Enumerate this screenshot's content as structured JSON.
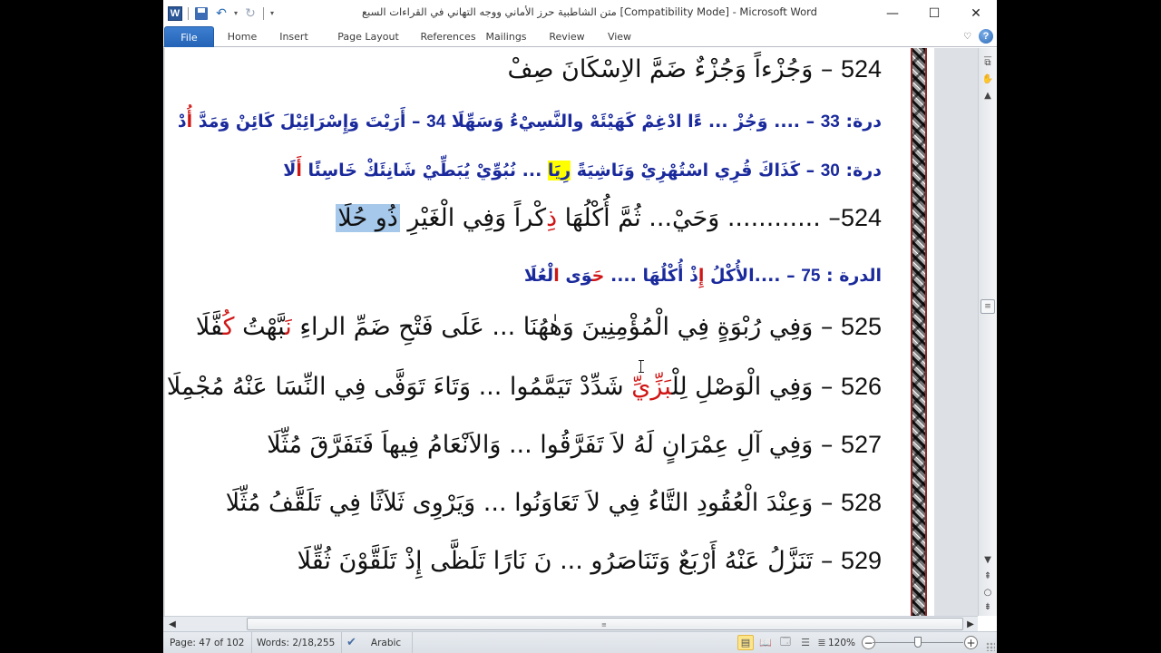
{
  "window": {
    "title": "متن الشاطبية حرز الأماني ووجه التهاني في القراءات السبع [Compatibility Mode]  -  Microsoft Word",
    "app_icon": "W",
    "controls": {
      "minimize": "—",
      "maximize": "☐",
      "close": "✕"
    }
  },
  "quick_access": [
    {
      "name": "save-icon"
    },
    {
      "name": "undo-icon",
      "glyph": "↶"
    },
    {
      "name": "undo-dropdown-icon",
      "glyph": "▾"
    },
    {
      "name": "redo-icon",
      "glyph": "↻"
    },
    {
      "name": "customize-qat-icon",
      "glyph": "▾"
    }
  ],
  "ribbon": {
    "tabs": [
      "File",
      "Home",
      "Insert",
      "Page Layout",
      "References",
      "Mailings",
      "Review",
      "View"
    ],
    "minimize_glyph": "♡",
    "help_glyph": "?"
  },
  "document": {
    "lines": [
      {
        "type": "verse",
        "num": "524",
        "parts": [
          {
            "t": " – وَجُزْءاً وَجُزْءٌ ضَمَّ الاِسْكَانَ صِفْ"
          }
        ]
      },
      {
        "type": "durra",
        "parts": [
          {
            "t": "درة: "
          },
          {
            "t": "33",
            "num": true
          },
          {
            "t": " – .... وَجُزْ ... ءًا ادْغِمْ كَهَيْئَهْ والنَّسِيْءُ وَسَهِّلَا "
          },
          {
            "t": "34",
            "num": true
          },
          {
            "t": " – أَرَيْتَ وَإِسْرَائِيْلَ كَائِنْ وَمَدَّ "
          },
          {
            "t": "أُ",
            "red": true
          },
          {
            "t": "دْ"
          }
        ]
      },
      {
        "type": "durra",
        "parts": [
          {
            "t": "درة: "
          },
          {
            "t": "30",
            "num": true
          },
          {
            "t": " – كَذَاكَ قُرِي اسْتُهْزِيْ وَنَاشِيَةً "
          },
          {
            "t": "رِيَا",
            "hl": "yellow"
          },
          {
            "t": " ... نُبُوِّيْ يُبَطِّيْ شَانِئَكْ خَاسِئًا "
          },
          {
            "t": "أَ",
            "red": true
          },
          {
            "t": "لَا"
          }
        ]
      },
      {
        "type": "verse",
        "parts": [
          {
            "t": "524",
            "num": true
          },
          {
            "t": "– ............ وَحَيْ... ثُمَّ أُكْلُهَا "
          },
          {
            "t": "ذِ",
            "red": true
          },
          {
            "t": "كْراً وَفِي الْغَيْرِ "
          },
          {
            "t": "ذُو حُلَا",
            "hl": "blue"
          }
        ]
      },
      {
        "type": "durra",
        "parts": [
          {
            "t": "الدرة : "
          },
          {
            "t": "75",
            "num": true
          },
          {
            "t": " – ....الأُكْلُ "
          },
          {
            "t": "إِ",
            "red": true
          },
          {
            "t": "ذْ أُكْلُهَا .... "
          },
          {
            "t": "حَ",
            "red": true
          },
          {
            "t": "وَى "
          },
          {
            "t": "ا",
            "red": true
          },
          {
            "t": "لْعُلَا"
          }
        ]
      },
      {
        "type": "verse",
        "parts": [
          {
            "t": "525",
            "num": true
          },
          {
            "t": " – وَفِي رُبْوَةٍ فِي الْمُؤْمِنِينَ وَهٰهُنَا ... عَلَى فَتْحِ ضَمِّ الراءِ "
          },
          {
            "t": "نَ",
            "red": true
          },
          {
            "t": "بَّهْتُ "
          },
          {
            "t": "كُ",
            "red": true
          },
          {
            "t": "فَّلَا"
          }
        ]
      },
      {
        "type": "verse",
        "parts": [
          {
            "t": "526",
            "num": true
          },
          {
            "t": " – وَفِي الْوَصْلِ لِلْ"
          },
          {
            "t": "بَزِّيِّ",
            "red": true
          },
          {
            "t": " شَدِّدْ تَيَمَّمُوا ... وَتَاءَ تَوَفَّى فِي النِّسَا عَنْهُ مُجْمِلَا"
          }
        ]
      },
      {
        "type": "verse",
        "parts": [
          {
            "t": "527",
            "num": true
          },
          {
            "t": " – وَفِي آلِ عِمْرَانٍ لَهُ لاَ تَفَرَّقُوا ... وَالاَنْعَامُ فِيهاَ فَتَفَرَّقَ مُثِّلَا"
          }
        ]
      },
      {
        "type": "verse",
        "parts": [
          {
            "t": "528",
            "num": true
          },
          {
            "t": " – وَعِنْدَ الْعُقُودِ التَّاءُ فِي لاَ تَعَاوَنُوا ... وَيَرْوِى ثَلاَثًا فِي تَلَقَّفُ مُثِّلَا"
          }
        ]
      },
      {
        "type": "verse",
        "parts": [
          {
            "t": "529",
            "num": true
          },
          {
            "t": " – تَنَزَّلُ عَنْهُ أَرْبَعٌ وَتَنَاصَرُو ... نَ نَارًا تَلَظَّى إِذْ تَلَقَّوْنَ ثُقِّلَا"
          }
        ]
      }
    ]
  },
  "scrollbars": {
    "up": "▲",
    "down": "▼",
    "prev_page": "⇞",
    "select_browse": "○",
    "next_page": "⇟",
    "left": "◀",
    "right": "▶",
    "thumb_grip": "≡",
    "split_icon": "—",
    "ruler_icon": "⧉",
    "hand_icon": "✋"
  },
  "statusbar": {
    "page": "Page: 47 of 102",
    "words": "Words: 2/18,255",
    "proofing_glyph": "✔",
    "language": "Arabic",
    "views": [
      {
        "name": "print-layout-view",
        "glyph": "▤",
        "active": true
      },
      {
        "name": "full-screen-reading-view",
        "glyph": "📖"
      },
      {
        "name": "web-layout-view",
        "glyph": "🗔"
      },
      {
        "name": "outline-view",
        "glyph": "☰"
      },
      {
        "name": "draft-view",
        "glyph": "≣"
      }
    ],
    "zoom_level": "120%",
    "zoom_fraction": 0.5,
    "zoom_out": "−",
    "zoom_in": "+"
  }
}
